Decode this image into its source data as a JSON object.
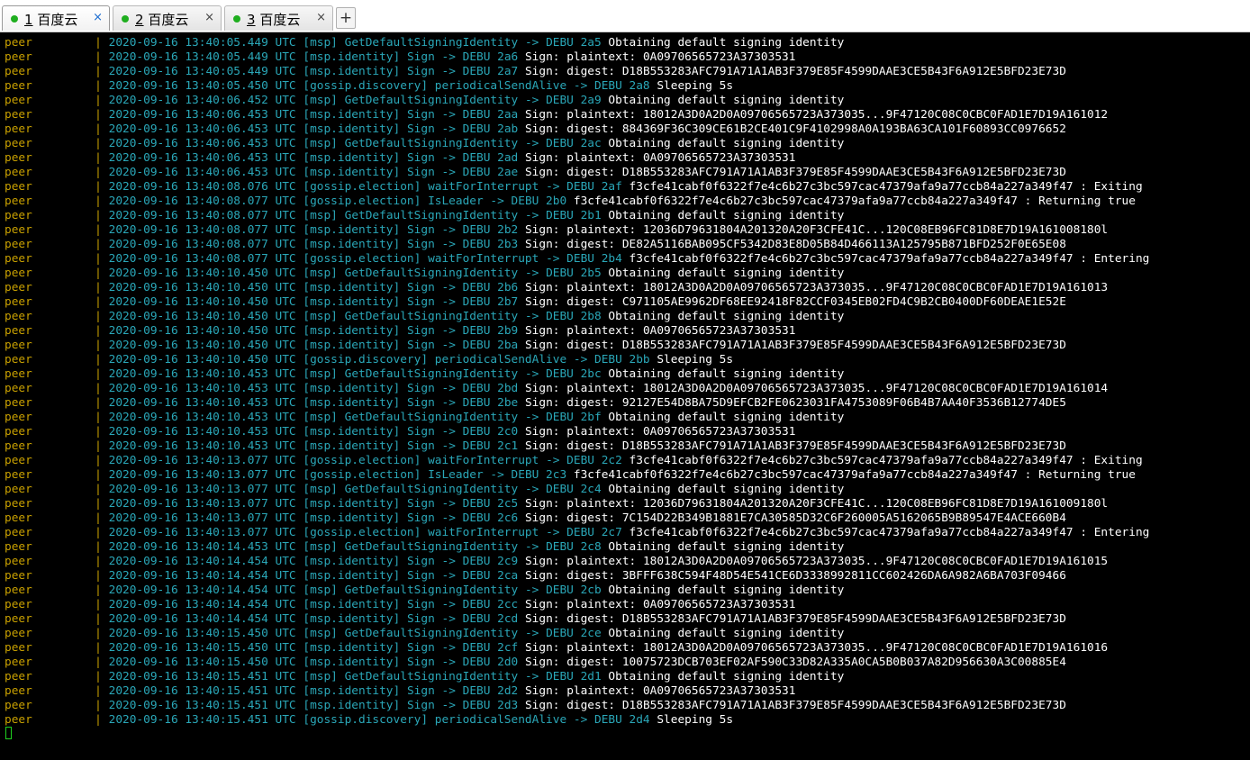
{
  "tabs": [
    {
      "num": "1",
      "title": "百度云",
      "active": true
    },
    {
      "num": "2",
      "title": "百度云",
      "active": false
    },
    {
      "num": "3",
      "title": "百度云",
      "active": false
    }
  ],
  "tab_close_glyph": "×",
  "new_tab_glyph": "+",
  "colors": {
    "service": "#c8a000",
    "log": "#2aa7b8",
    "message": "#ffffff",
    "status_dot": "#1fae1f"
  },
  "log_lines": [
    {
      "service": "peer",
      "sep": "|",
      "ts": "2020-09-16 13:40:05.449 UTC",
      "module": "[msp]",
      "func": "GetDefaultSigningIdentity",
      "level": "-> DEBU 2a5",
      "msg": "Obtaining default signing identity"
    },
    {
      "service": "peer",
      "sep": "|",
      "ts": "2020-09-16 13:40:05.449 UTC",
      "module": "[msp.identity]",
      "func": "Sign",
      "level": "-> DEBU 2a6",
      "msg": "Sign: plaintext: 0A09706565723A37303531"
    },
    {
      "service": "peer",
      "sep": "|",
      "ts": "2020-09-16 13:40:05.449 UTC",
      "module": "[msp.identity]",
      "func": "Sign",
      "level": "-> DEBU 2a7",
      "msg": "Sign: digest: D18B553283AFC791A71A1AB3F379E85F4599DAAE3CE5B43F6A912E5BFD23E73D"
    },
    {
      "service": "peer",
      "sep": "|",
      "ts": "2020-09-16 13:40:05.450 UTC",
      "module": "[gossip.discovery]",
      "func": "periodicalSendAlive",
      "level": "-> DEBU 2a8",
      "msg": "Sleeping 5s"
    },
    {
      "service": "peer",
      "sep": "|",
      "ts": "2020-09-16 13:40:06.452 UTC",
      "module": "[msp]",
      "func": "GetDefaultSigningIdentity",
      "level": "-> DEBU 2a9",
      "msg": "Obtaining default signing identity"
    },
    {
      "service": "peer",
      "sep": "|",
      "ts": "2020-09-16 13:40:06.453 UTC",
      "module": "[msp.identity]",
      "func": "Sign",
      "level": "-> DEBU 2aa",
      "msg": "Sign: plaintext: 18012A3D0A2D0A09706565723A373035...9F47120C08C0CBC0FAD1E7D19A161012"
    },
    {
      "service": "peer",
      "sep": "|",
      "ts": "2020-09-16 13:40:06.453 UTC",
      "module": "[msp.identity]",
      "func": "Sign",
      "level": "-> DEBU 2ab",
      "msg": "Sign: digest: 884369F36C309CE61B2CE401C9F4102998A0A193BA63CA101F60893CC0976652"
    },
    {
      "service": "peer",
      "sep": "|",
      "ts": "2020-09-16 13:40:06.453 UTC",
      "module": "[msp]",
      "func": "GetDefaultSigningIdentity",
      "level": "-> DEBU 2ac",
      "msg": "Obtaining default signing identity"
    },
    {
      "service": "peer",
      "sep": "|",
      "ts": "2020-09-16 13:40:06.453 UTC",
      "module": "[msp.identity]",
      "func": "Sign",
      "level": "-> DEBU 2ad",
      "msg": "Sign: plaintext: 0A09706565723A37303531"
    },
    {
      "service": "peer",
      "sep": "|",
      "ts": "2020-09-16 13:40:06.453 UTC",
      "module": "[msp.identity]",
      "func": "Sign",
      "level": "-> DEBU 2ae",
      "msg": "Sign: digest: D18B553283AFC791A71A1AB3F379E85F4599DAAE3CE5B43F6A912E5BFD23E73D"
    },
    {
      "service": "peer",
      "sep": "|",
      "ts": "2020-09-16 13:40:08.076 UTC",
      "module": "[gossip.election]",
      "func": "waitForInterrupt",
      "level": "-> DEBU 2af",
      "msg": "f3cfe41cabf0f6322f7e4c6b27c3bc597cac47379afa9a77ccb84a227a349f47 : Exiting"
    },
    {
      "service": "peer",
      "sep": "|",
      "ts": "2020-09-16 13:40:08.077 UTC",
      "module": "[gossip.election]",
      "func": "IsLeader",
      "level": "-> DEBU 2b0",
      "msg": "f3cfe41cabf0f6322f7e4c6b27c3bc597cac47379afa9a77ccb84a227a349f47 : Returning true"
    },
    {
      "service": "peer",
      "sep": "|",
      "ts": "2020-09-16 13:40:08.077 UTC",
      "module": "[msp]",
      "func": "GetDefaultSigningIdentity",
      "level": "-> DEBU 2b1",
      "msg": "Obtaining default signing identity"
    },
    {
      "service": "peer",
      "sep": "|",
      "ts": "2020-09-16 13:40:08.077 UTC",
      "module": "[msp.identity]",
      "func": "Sign",
      "level": "-> DEBU 2b2",
      "msg": "Sign: plaintext: 12036D79631804A201320A20F3CFE41C...120C08EB96FC81D8E7D19A161008180l"
    },
    {
      "service": "peer",
      "sep": "|",
      "ts": "2020-09-16 13:40:08.077 UTC",
      "module": "[msp.identity]",
      "func": "Sign",
      "level": "-> DEBU 2b3",
      "msg": "Sign: digest: DE82A5116BAB095CF5342D83E8D05B84D466113A125795B871BFD252F0E65E08"
    },
    {
      "service": "peer",
      "sep": "|",
      "ts": "2020-09-16 13:40:08.077 UTC",
      "module": "[gossip.election]",
      "func": "waitForInterrupt",
      "level": "-> DEBU 2b4",
      "msg": "f3cfe41cabf0f6322f7e4c6b27c3bc597cac47379afa9a77ccb84a227a349f47 : Entering"
    },
    {
      "service": "peer",
      "sep": "|",
      "ts": "2020-09-16 13:40:10.450 UTC",
      "module": "[msp]",
      "func": "GetDefaultSigningIdentity",
      "level": "-> DEBU 2b5",
      "msg": "Obtaining default signing identity"
    },
    {
      "service": "peer",
      "sep": "|",
      "ts": "2020-09-16 13:40:10.450 UTC",
      "module": "[msp.identity]",
      "func": "Sign",
      "level": "-> DEBU 2b6",
      "msg": "Sign: plaintext: 18012A3D0A2D0A09706565723A373035...9F47120C08C0CBC0FAD1E7D19A161013"
    },
    {
      "service": "peer",
      "sep": "|",
      "ts": "2020-09-16 13:40:10.450 UTC",
      "module": "[msp.identity]",
      "func": "Sign",
      "level": "-> DEBU 2b7",
      "msg": "Sign: digest: C971105AE9962DF68EE92418F82CCF0345EB02FD4C9B2CB0400DF60DEAE1E52E"
    },
    {
      "service": "peer",
      "sep": "|",
      "ts": "2020-09-16 13:40:10.450 UTC",
      "module": "[msp]",
      "func": "GetDefaultSigningIdentity",
      "level": "-> DEBU 2b8",
      "msg": "Obtaining default signing identity"
    },
    {
      "service": "peer",
      "sep": "|",
      "ts": "2020-09-16 13:40:10.450 UTC",
      "module": "[msp.identity]",
      "func": "Sign",
      "level": "-> DEBU 2b9",
      "msg": "Sign: plaintext: 0A09706565723A37303531"
    },
    {
      "service": "peer",
      "sep": "|",
      "ts": "2020-09-16 13:40:10.450 UTC",
      "module": "[msp.identity]",
      "func": "Sign",
      "level": "-> DEBU 2ba",
      "msg": "Sign: digest: D18B553283AFC791A71A1AB3F379E85F4599DAAE3CE5B43F6A912E5BFD23E73D"
    },
    {
      "service": "peer",
      "sep": "|",
      "ts": "2020-09-16 13:40:10.450 UTC",
      "module": "[gossip.discovery]",
      "func": "periodicalSendAlive",
      "level": "-> DEBU 2bb",
      "msg": "Sleeping 5s"
    },
    {
      "service": "peer",
      "sep": "|",
      "ts": "2020-09-16 13:40:10.453 UTC",
      "module": "[msp]",
      "func": "GetDefaultSigningIdentity",
      "level": "-> DEBU 2bc",
      "msg": "Obtaining default signing identity"
    },
    {
      "service": "peer",
      "sep": "|",
      "ts": "2020-09-16 13:40:10.453 UTC",
      "module": "[msp.identity]",
      "func": "Sign",
      "level": "-> DEBU 2bd",
      "msg": "Sign: plaintext: 18012A3D0A2D0A09706565723A373035...9F47120C08C0CBC0FAD1E7D19A161014"
    },
    {
      "service": "peer",
      "sep": "|",
      "ts": "2020-09-16 13:40:10.453 UTC",
      "module": "[msp.identity]",
      "func": "Sign",
      "level": "-> DEBU 2be",
      "msg": "Sign: digest: 92127E54D8BA75D9EFCB2FE0623031FA4753089F06B4B7AA40F3536B12774DE5"
    },
    {
      "service": "peer",
      "sep": "|",
      "ts": "2020-09-16 13:40:10.453 UTC",
      "module": "[msp]",
      "func": "GetDefaultSigningIdentity",
      "level": "-> DEBU 2bf",
      "msg": "Obtaining default signing identity"
    },
    {
      "service": "peer",
      "sep": "|",
      "ts": "2020-09-16 13:40:10.453 UTC",
      "module": "[msp.identity]",
      "func": "Sign",
      "level": "-> DEBU 2c0",
      "msg": "Sign: plaintext: 0A09706565723A37303531"
    },
    {
      "service": "peer",
      "sep": "|",
      "ts": "2020-09-16 13:40:10.453 UTC",
      "module": "[msp.identity]",
      "func": "Sign",
      "level": "-> DEBU 2c1",
      "msg": "Sign: digest: D18B553283AFC791A71A1AB3F379E85F4599DAAE3CE5B43F6A912E5BFD23E73D"
    },
    {
      "service": "peer",
      "sep": "|",
      "ts": "2020-09-16 13:40:13.077 UTC",
      "module": "[gossip.election]",
      "func": "waitForInterrupt",
      "level": "-> DEBU 2c2",
      "msg": "f3cfe41cabf0f6322f7e4c6b27c3bc597cac47379afa9a77ccb84a227a349f47 : Exiting"
    },
    {
      "service": "peer",
      "sep": "|",
      "ts": "2020-09-16 13:40:13.077 UTC",
      "module": "[gossip.election]",
      "func": "IsLeader",
      "level": "-> DEBU 2c3",
      "msg": "f3cfe41cabf0f6322f7e4c6b27c3bc597cac47379afa9a77ccb84a227a349f47 : Returning true"
    },
    {
      "service": "peer",
      "sep": "|",
      "ts": "2020-09-16 13:40:13.077 UTC",
      "module": "[msp]",
      "func": "GetDefaultSigningIdentity",
      "level": "-> DEBU 2c4",
      "msg": "Obtaining default signing identity"
    },
    {
      "service": "peer",
      "sep": "|",
      "ts": "2020-09-16 13:40:13.077 UTC",
      "module": "[msp.identity]",
      "func": "Sign",
      "level": "-> DEBU 2c5",
      "msg": "Sign: plaintext: 12036D79631804A201320A20F3CFE41C...120C08EB96FC81D8E7D19A161009180l"
    },
    {
      "service": "peer",
      "sep": "|",
      "ts": "2020-09-16 13:40:13.077 UTC",
      "module": "[msp.identity]",
      "func": "Sign",
      "level": "-> DEBU 2c6",
      "msg": "Sign: digest: 7C154D22B349B1881E7CA30585D32C6F260005A5162065B9B89547E4ACE660B4"
    },
    {
      "service": "peer",
      "sep": "|",
      "ts": "2020-09-16 13:40:13.077 UTC",
      "module": "[gossip.election]",
      "func": "waitForInterrupt",
      "level": "-> DEBU 2c7",
      "msg": "f3cfe41cabf0f6322f7e4c6b27c3bc597cac47379afa9a77ccb84a227a349f47 : Entering"
    },
    {
      "service": "peer",
      "sep": "|",
      "ts": "2020-09-16 13:40:14.453 UTC",
      "module": "[msp]",
      "func": "GetDefaultSigningIdentity",
      "level": "-> DEBU 2c8",
      "msg": "Obtaining default signing identity"
    },
    {
      "service": "peer",
      "sep": "|",
      "ts": "2020-09-16 13:40:14.454 UTC",
      "module": "[msp.identity]",
      "func": "Sign",
      "level": "-> DEBU 2c9",
      "msg": "Sign: plaintext: 18012A3D0A2D0A09706565723A373035...9F47120C08C0CBC0FAD1E7D19A161015"
    },
    {
      "service": "peer",
      "sep": "|",
      "ts": "2020-09-16 13:40:14.454 UTC",
      "module": "[msp.identity]",
      "func": "Sign",
      "level": "-> DEBU 2ca",
      "msg": "Sign: digest: 3BFFF638C594F48D54E541CE6D3338992811CC602426DA6A982A6BA703F09466"
    },
    {
      "service": "peer",
      "sep": "|",
      "ts": "2020-09-16 13:40:14.454 UTC",
      "module": "[msp]",
      "func": "GetDefaultSigningIdentity",
      "level": "-> DEBU 2cb",
      "msg": "Obtaining default signing identity"
    },
    {
      "service": "peer",
      "sep": "|",
      "ts": "2020-09-16 13:40:14.454 UTC",
      "module": "[msp.identity]",
      "func": "Sign",
      "level": "-> DEBU 2cc",
      "msg": "Sign: plaintext: 0A09706565723A37303531"
    },
    {
      "service": "peer",
      "sep": "|",
      "ts": "2020-09-16 13:40:14.454 UTC",
      "module": "[msp.identity]",
      "func": "Sign",
      "level": "-> DEBU 2cd",
      "msg": "Sign: digest: D18B553283AFC791A71A1AB3F379E85F4599DAAE3CE5B43F6A912E5BFD23E73D"
    },
    {
      "service": "peer",
      "sep": "|",
      "ts": "2020-09-16 13:40:15.450 UTC",
      "module": "[msp]",
      "func": "GetDefaultSigningIdentity",
      "level": "-> DEBU 2ce",
      "msg": "Obtaining default signing identity"
    },
    {
      "service": "peer",
      "sep": "|",
      "ts": "2020-09-16 13:40:15.450 UTC",
      "module": "[msp.identity]",
      "func": "Sign",
      "level": "-> DEBU 2cf",
      "msg": "Sign: plaintext: 18012A3D0A2D0A09706565723A373035...9F47120C08C0CBC0FAD1E7D19A161016"
    },
    {
      "service": "peer",
      "sep": "|",
      "ts": "2020-09-16 13:40:15.450 UTC",
      "module": "[msp.identity]",
      "func": "Sign",
      "level": "-> DEBU 2d0",
      "msg": "Sign: digest: 10075723DCB703EF02AF590C33D82A335A0CA5B0B037A82D956630A3C00885E4"
    },
    {
      "service": "peer",
      "sep": "|",
      "ts": "2020-09-16 13:40:15.451 UTC",
      "module": "[msp]",
      "func": "GetDefaultSigningIdentity",
      "level": "-> DEBU 2d1",
      "msg": "Obtaining default signing identity"
    },
    {
      "service": "peer",
      "sep": "|",
      "ts": "2020-09-16 13:40:15.451 UTC",
      "module": "[msp.identity]",
      "func": "Sign",
      "level": "-> DEBU 2d2",
      "msg": "Sign: plaintext: 0A09706565723A37303531"
    },
    {
      "service": "peer",
      "sep": "|",
      "ts": "2020-09-16 13:40:15.451 UTC",
      "module": "[msp.identity]",
      "func": "Sign",
      "level": "-> DEBU 2d3",
      "msg": "Sign: digest: D18B553283AFC791A71A1AB3F379E85F4599DAAE3CE5B43F6A912E5BFD23E73D"
    },
    {
      "service": "peer",
      "sep": "|",
      "ts": "2020-09-16 13:40:15.451 UTC",
      "module": "[gossip.discovery]",
      "func": "periodicalSendAlive",
      "level": "-> DEBU 2d4",
      "msg": "Sleeping 5s"
    }
  ]
}
